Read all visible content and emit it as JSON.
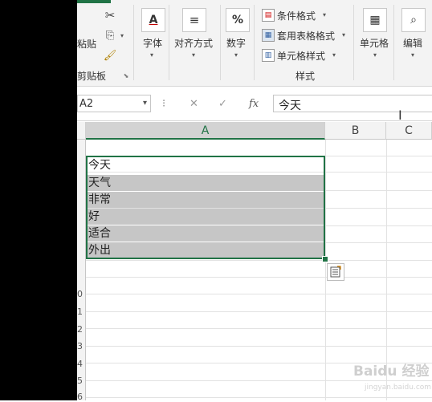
{
  "ribbon": {
    "clipboard": {
      "paste_label": "粘贴",
      "group_label": "剪贴板"
    },
    "font": {
      "icon_letter": "A",
      "label": "字体"
    },
    "alignment": {
      "label": "对齐方式"
    },
    "number": {
      "icon_symbol": "%",
      "label": "数字"
    },
    "styles": {
      "conditional_format": "条件格式",
      "format_as_table": "套用表格格式",
      "cell_styles": "单元格样式",
      "group_label": "样式"
    },
    "cells": {
      "label": "单元格"
    },
    "editing": {
      "label": "编辑"
    }
  },
  "formula_bar": {
    "name_box": "A2",
    "fx": "fx",
    "cancel": "✕",
    "enter": "✓",
    "content": "今天"
  },
  "columns": [
    "A",
    "B",
    "C"
  ],
  "rows": [
    {
      "num": "",
      "text": "今天"
    },
    {
      "num": "",
      "text": "天气"
    },
    {
      "num": "",
      "text": "非常"
    },
    {
      "num": "",
      "text": "好"
    },
    {
      "num": "",
      "text": "适合"
    },
    {
      "num": "",
      "text": "外出"
    }
  ],
  "row_numbers_tail": [
    "0",
    "1",
    "2",
    "3",
    "4",
    "5",
    "6"
  ],
  "watermark": {
    "main": "Baidu 经验",
    "sub": "jingyan.baidu.com"
  },
  "colors": {
    "accent": "#217346",
    "selection_fill": "#c6c6c6"
  }
}
